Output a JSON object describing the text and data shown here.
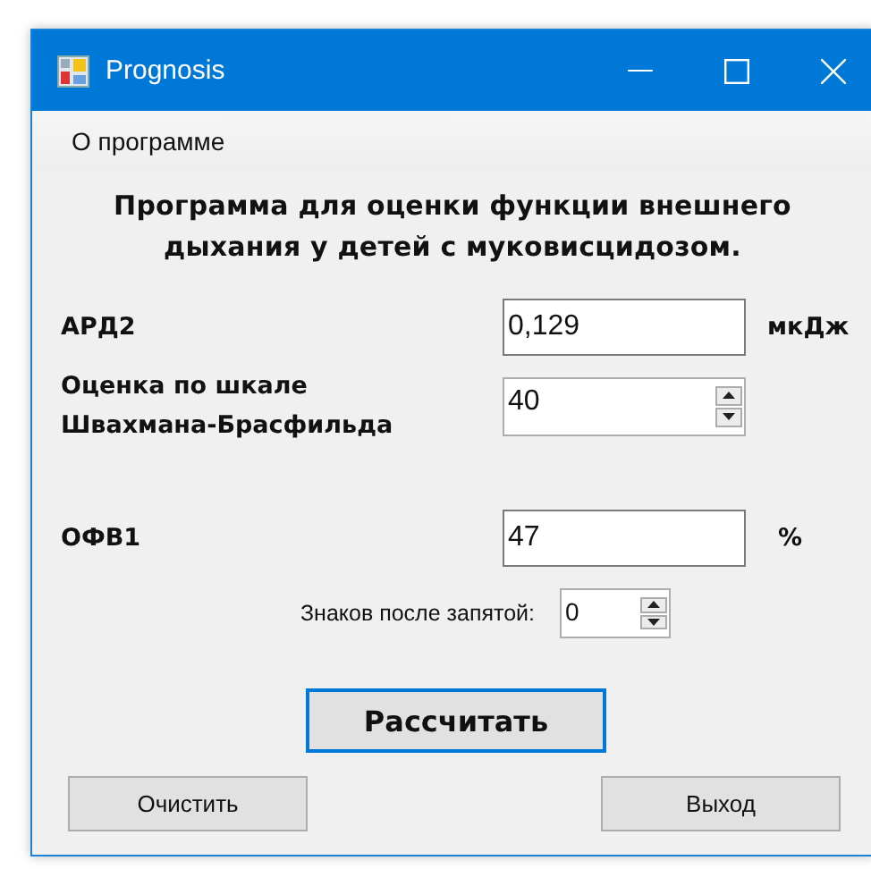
{
  "window": {
    "title": "Prognosis"
  },
  "menu": [
    {
      "label": "О программе"
    }
  ],
  "heading": "Программа для оценки функции внешнего\nдыхания у детей с муковисцидозом.",
  "fields": [
    {
      "kind": "text",
      "label": "АРД2",
      "value": "0,129",
      "unit": "мкДж"
    },
    {
      "kind": "spin",
      "label": "Оценка по шкале\nШвахмана-Брасфильда",
      "value": "40"
    },
    {
      "kind": "text",
      "label": "ОФВ1",
      "value": "47",
      "unit": "%"
    }
  ],
  "decimals": {
    "label": "Знаков после запятой:",
    "value": "0"
  },
  "calculate_button": {
    "label": "Рассчитать",
    "focused": true
  },
  "buttons": [
    {
      "label": "Очистить"
    },
    {
      "label": "Выход"
    }
  ]
}
